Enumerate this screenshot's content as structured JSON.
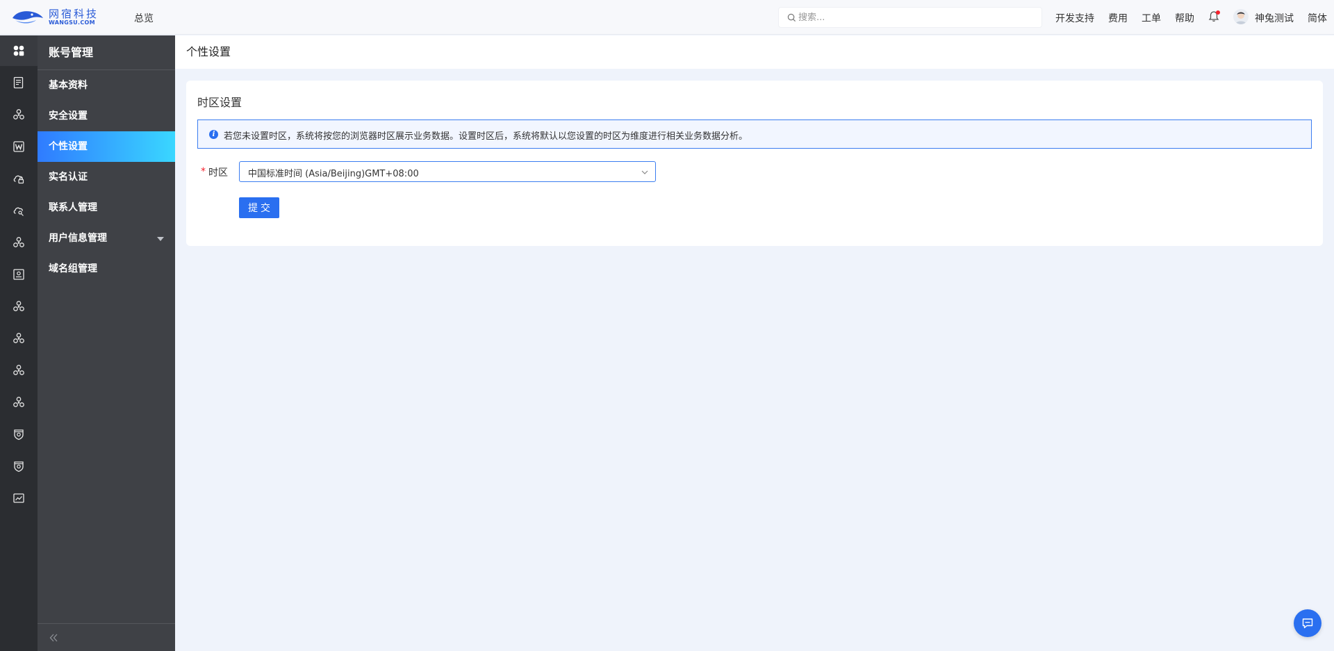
{
  "header": {
    "logo_cn": "网宿科技",
    "logo_en": "WANGSU.COM",
    "overview": "总览",
    "search_placeholder": "搜索...",
    "links": {
      "dev": "开发支持",
      "fee": "费用",
      "ticket": "工单",
      "help": "帮助"
    },
    "user_name": "神兔测试",
    "language": "简体"
  },
  "rail": {
    "items": [
      "apps-icon",
      "doc-list-icon",
      "cluster-icon",
      "w-icon",
      "cloud-lock-icon",
      "cloud-key-icon",
      "cluster-icon",
      "monitor-icon",
      "cluster-icon",
      "cluster-icon",
      "cluster-icon",
      "cluster-icon",
      "shield-icon",
      "shield-icon",
      "chart-icon"
    ]
  },
  "submenu": {
    "title": "账号管理",
    "items": [
      {
        "label": "基本资料"
      },
      {
        "label": "安全设置"
      },
      {
        "label": "个性设置"
      },
      {
        "label": "实名认证"
      },
      {
        "label": "联系人管理"
      },
      {
        "label": "用户信息管理"
      },
      {
        "label": "域名组管理"
      }
    ],
    "active_index": 2
  },
  "page": {
    "title": "个性设置",
    "card_title": "时区设置",
    "alert": "若您未设置时区，系统将按您的浏览器时区展示业务数据。设置时区后，系统将默认以您设置的时区为维度进行相关业务数据分析。",
    "timezone_label": "时区",
    "timezone_value": "中国标准时间 (Asia/Beijing)GMT+08:00",
    "submit_label": "提交"
  },
  "colors": {
    "primary": "#2a6ff0",
    "rail_bg": "#2b2d31",
    "submenu_bg": "#3f4146",
    "page_bg": "#eff3fb"
  }
}
